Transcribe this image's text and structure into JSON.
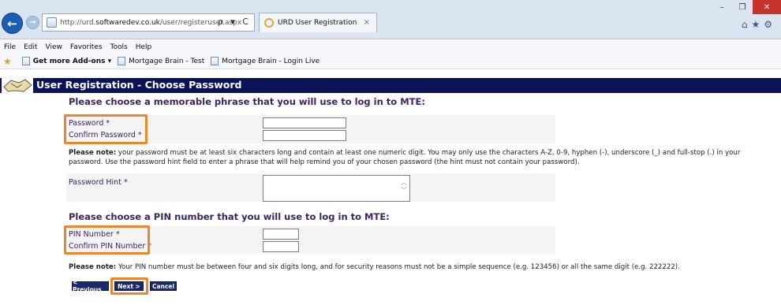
{
  "browser": {
    "url_prefix": "http://urd.",
    "url_host": "softwaredev.co.uk",
    "url_path": "/user/registeruser.aspx",
    "address_tools": "ρ ▾ C",
    "tab_title": "URD User Registration",
    "tab_close": "×",
    "back_icon": "←",
    "forward_icon": "→",
    "win_minimize": "–",
    "win_maximize": "❐",
    "win_close": "✕",
    "toolbar_icons": "⌂★⚙"
  },
  "menubar": {
    "items": [
      "File",
      "Edit",
      "View",
      "Favorites",
      "Tools",
      "Help"
    ]
  },
  "favbar": {
    "star": "★",
    "add_ons": "Get more Add-ons ▾",
    "link1": "Mortgage Brain - Test",
    "link2": "Mortgage Brain - Login Live"
  },
  "page": {
    "title": "User Registration - Choose Password",
    "password_section_title": "Please choose a memorable phrase that you will use to log in to MTE:",
    "password_label": "Password *",
    "confirm_password_label": "Confirm Password *",
    "password_note_strong": "Please note:",
    "password_note_text": " your password must be at least six characters long and contain at least one numeric digit. You may only use the characters A-Z, 0-9, hyphen (-), underscore (_) and full-stop (.) in your password. Use the password hint field to enter a phrase that will help remind you of your chosen password (the hint must not contain your password).",
    "password_hint_label": "Password Hint *",
    "pin_section_title": "Please choose a PIN number that you will use to log in to MTE:",
    "pin_label": "PIN Number *",
    "confirm_pin_label": "Confirm PIN Number *",
    "pin_note_strong": "Please note:",
    "pin_note_text": " Your PIN number must be between four and six digits long, and for security reasons must not be a simple sequence (e.g. 123456) or all the same digit (e.g. 222222).",
    "previous_button": "< Previous",
    "next_button": "Next >",
    "cancel_button": "Cancel"
  },
  "colors": {
    "header_bg": "#0b1456",
    "highlight": "#e8872e",
    "section_text": "#3d2266"
  }
}
